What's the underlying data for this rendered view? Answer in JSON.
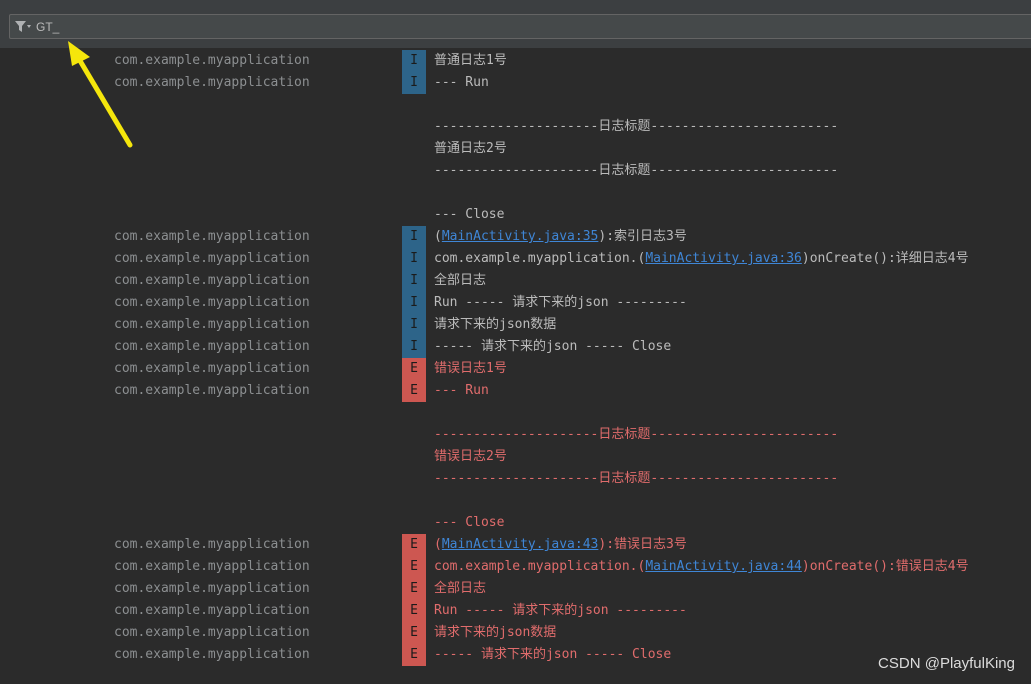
{
  "filter": {
    "value": "GT_",
    "icon": "filter-icon"
  },
  "log": {
    "rows": [
      {
        "pkg": "com.example.myapplication",
        "level": "I",
        "parts": [
          {
            "t": "普通日志1号"
          }
        ]
      },
      {
        "pkg": "com.example.myapplication",
        "level": "I",
        "parts": [
          {
            "t": "--- Run"
          }
        ]
      },
      {
        "pkg": "",
        "level": "",
        "cls": "I",
        "parts": [
          {
            "t": ""
          }
        ]
      },
      {
        "pkg": "",
        "level": "",
        "cls": "I",
        "parts": [
          {
            "t": "---------------------日志标题------------------------"
          }
        ]
      },
      {
        "pkg": "",
        "level": "",
        "cls": "I",
        "parts": [
          {
            "t": "普通日志2号"
          }
        ]
      },
      {
        "pkg": "",
        "level": "",
        "cls": "I",
        "parts": [
          {
            "t": "---------------------日志标题------------------------"
          }
        ]
      },
      {
        "pkg": "",
        "level": "",
        "cls": "I",
        "parts": [
          {
            "t": ""
          }
        ]
      },
      {
        "pkg": "",
        "level": "",
        "cls": "I",
        "parts": [
          {
            "t": "--- Close"
          }
        ]
      },
      {
        "pkg": "com.example.myapplication",
        "level": "I",
        "parts": [
          {
            "t": "("
          },
          {
            "t": "MainActivity.java:35",
            "link": true
          },
          {
            "t": "):索引日志3号"
          }
        ]
      },
      {
        "pkg": "com.example.myapplication",
        "level": "I",
        "parts": [
          {
            "t": "com.example.myapplication.("
          },
          {
            "t": "MainActivity.java:36",
            "link": true
          },
          {
            "t": ")onCreate():详细日志4号"
          }
        ]
      },
      {
        "pkg": "com.example.myapplication",
        "level": "I",
        "parts": [
          {
            "t": "全部日志"
          }
        ]
      },
      {
        "pkg": "com.example.myapplication",
        "level": "I",
        "parts": [
          {
            "t": "Run ----- 请求下来的json ---------"
          }
        ]
      },
      {
        "pkg": "com.example.myapplication",
        "level": "I",
        "parts": [
          {
            "t": "请求下来的json数据"
          }
        ]
      },
      {
        "pkg": "com.example.myapplication",
        "level": "I",
        "parts": [
          {
            "t": "----- 请求下来的json ----- Close"
          }
        ]
      },
      {
        "pkg": "com.example.myapplication",
        "level": "E",
        "parts": [
          {
            "t": "错误日志1号"
          }
        ]
      },
      {
        "pkg": "com.example.myapplication",
        "level": "E",
        "parts": [
          {
            "t": "--- Run"
          }
        ]
      },
      {
        "pkg": "",
        "level": "",
        "cls": "E",
        "parts": [
          {
            "t": ""
          }
        ]
      },
      {
        "pkg": "",
        "level": "",
        "cls": "E",
        "parts": [
          {
            "t": "---------------------日志标题------------------------"
          }
        ]
      },
      {
        "pkg": "",
        "level": "",
        "cls": "E",
        "parts": [
          {
            "t": "错误日志2号"
          }
        ]
      },
      {
        "pkg": "",
        "level": "",
        "cls": "E",
        "parts": [
          {
            "t": "---------------------日志标题------------------------"
          }
        ]
      },
      {
        "pkg": "",
        "level": "",
        "cls": "E",
        "parts": [
          {
            "t": ""
          }
        ]
      },
      {
        "pkg": "",
        "level": "",
        "cls": "E",
        "parts": [
          {
            "t": "--- Close"
          }
        ]
      },
      {
        "pkg": "com.example.myapplication",
        "level": "E",
        "parts": [
          {
            "t": "("
          },
          {
            "t": "MainActivity.java:43",
            "link": true
          },
          {
            "t": "):错误日志3号"
          }
        ]
      },
      {
        "pkg": "com.example.myapplication",
        "level": "E",
        "parts": [
          {
            "t": "com.example.myapplication.("
          },
          {
            "t": "MainActivity.java:44",
            "link": true
          },
          {
            "t": ")onCreate():错误日志4号"
          }
        ]
      },
      {
        "pkg": "com.example.myapplication",
        "level": "E",
        "parts": [
          {
            "t": "全部日志"
          }
        ]
      },
      {
        "pkg": "com.example.myapplication",
        "level": "E",
        "parts": [
          {
            "t": "Run ----- 请求下来的json ---------"
          }
        ]
      },
      {
        "pkg": "com.example.myapplication",
        "level": "E",
        "parts": [
          {
            "t": "请求下来的json数据"
          }
        ]
      },
      {
        "pkg": "com.example.myapplication",
        "level": "E",
        "parts": [
          {
            "t": "----- 请求下来的json ----- Close"
          }
        ]
      }
    ]
  },
  "watermark": "CSDN @PlayfulKing",
  "colors": {
    "background": "#2b2b2b",
    "info_badge": "#2d6489",
    "error_badge": "#cd5751",
    "info_text": "#bbbbbb",
    "error_text": "#e06c6c",
    "link": "#3f86d6",
    "arrow": "#f5e60c"
  }
}
